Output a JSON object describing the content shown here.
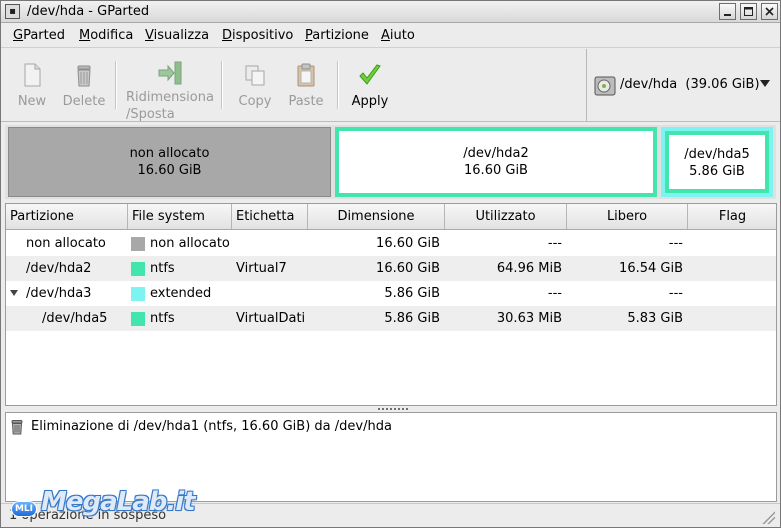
{
  "window": {
    "title": "/dev/hda - GParted"
  },
  "menubar": {
    "items": [
      {
        "u": "G",
        "rest": "Parted"
      },
      {
        "u": "M",
        "rest": "odifica"
      },
      {
        "u": "V",
        "rest": "isualizza"
      },
      {
        "u": "D",
        "rest": "ispositivo"
      },
      {
        "u": "P",
        "rest": "artizione"
      },
      {
        "u": "A",
        "rest": "iuto"
      }
    ]
  },
  "toolbar": {
    "new_label": "New",
    "delete_label": "Delete",
    "resize_label_1": "Ridimensiona",
    "resize_label_2": "/Sposta",
    "copy_label": "Copy",
    "paste_label": "Paste",
    "apply_label": "Apply"
  },
  "device": {
    "label": "/dev/hda  (39.06 GiB)"
  },
  "partition_map": {
    "unallocated": {
      "name": "non allocato",
      "size": "16.60 GiB"
    },
    "hda2": {
      "name": "/dev/hda2",
      "size": "16.60 GiB"
    },
    "hda5": {
      "name": "/dev/hda5",
      "size": "5.86 GiB"
    }
  },
  "table": {
    "headers": [
      "Partizione",
      "File system",
      "Etichetta",
      "Dimensione",
      "Utilizzato",
      "Libero",
      "Flag"
    ],
    "rows": [
      {
        "partition": "non allocato",
        "fs": "non allocato",
        "fs_color": "#a8a8a8",
        "label": "",
        "size": "16.60 GiB",
        "used": "---",
        "free": "---",
        "flag": ""
      },
      {
        "partition": "/dev/hda2",
        "fs": "ntfs",
        "fs_color": "#42e5ac",
        "label": "Virtual7",
        "size": "16.60 GiB",
        "used": "64.96 MiB",
        "free": "16.54 GiB",
        "flag": ""
      },
      {
        "partition": "/dev/hda3",
        "fs": "extended",
        "fs_color": "#7df4f2",
        "label": "",
        "size": "5.86 GiB",
        "used": "---",
        "free": "---",
        "flag": ""
      },
      {
        "partition": "/dev/hda5",
        "fs": "ntfs",
        "fs_color": "#42e5ac",
        "label": "VirtualDati",
        "size": "5.86 GiB",
        "used": "30.63 MiB",
        "free": "5.83 GiB",
        "flag": ""
      }
    ]
  },
  "operations": {
    "items": [
      "Eliminazione di /dev/hda1 (ntfs, 16.60 GiB) da /dev/hda"
    ]
  },
  "statusbar": {
    "text": "1 operazione in sospeso"
  },
  "watermark": {
    "badge": "MLI",
    "text": "MegaLab.it"
  }
}
